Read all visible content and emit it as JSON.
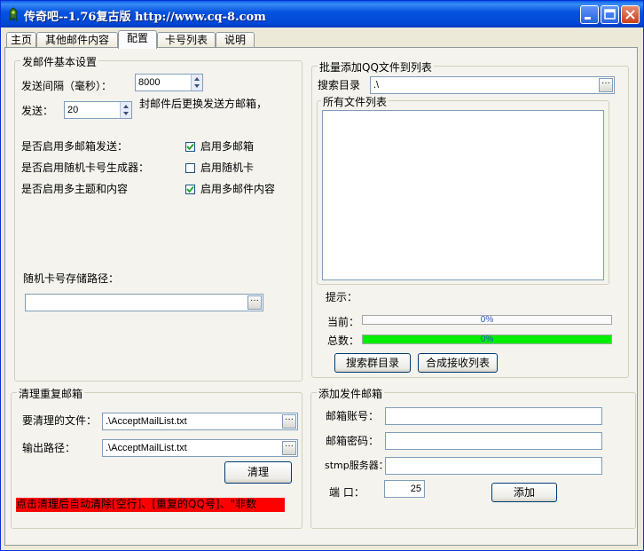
{
  "window": {
    "title": "传奇吧--1.76复古版 http://www.cq-8.com"
  },
  "tabs": [
    "主页",
    "其他邮件内容",
    "配置",
    "卡号列表",
    "说明"
  ],
  "mail_settings": {
    "legend": "发邮件基本设置",
    "interval_label": "发送间隔（毫秒）：",
    "interval_value": "8000",
    "send_label": "发送：",
    "send_value": "20",
    "send_suffix": "封邮件后更换发送方邮箱，",
    "multi_mailbox_label": "是否启用多邮箱发送：",
    "multi_mailbox_check": "启用多邮箱",
    "multi_mailbox_checked": true,
    "random_card_label": "是否启用随机卡号生成器：",
    "random_card_check": "启用随机卡",
    "random_card_checked": false,
    "multi_subject_label": "是否启用多主题和内容",
    "multi_subject_check": "启用多邮件内容",
    "multi_subject_checked": true,
    "card_path_label": "随机卡号存储路径：",
    "card_path_value": ""
  },
  "batch_add": {
    "legend": "批量添加QQ文件到列表",
    "search_dir_label": "搜索目录",
    "search_dir_value": ".\\",
    "file_list_legend": "所有文件列表",
    "hint_label": "提示：",
    "current_label": "当前：",
    "current_progress": "0%",
    "current_fraction": 0,
    "total_label": "总数：",
    "total_progress": "0%",
    "total_fraction": 1,
    "search_button": "搜索群目录",
    "merge_button": "合成接收列表"
  },
  "cleanup": {
    "legend": "清理重复邮箱",
    "file_label": "要清理的文件：",
    "file_value": ".\\AcceptMailList.txt",
    "output_label": "输出路径：",
    "output_value": ".\\AcceptMailList.txt",
    "clean_button": "清理",
    "warning": "点击清理后自动清除[空行]、[重复的QQ号]、\"非数"
  },
  "add_sender": {
    "legend": "添加发件邮箱",
    "account_label": "邮箱账号：",
    "password_label": "邮箱密码：",
    "smtp_label": "stmp服务器：",
    "port_label": "端  口：",
    "port_value": "25",
    "add_button": "添加"
  },
  "colors": {
    "titlebar": "#0054e3",
    "progress_fill": "#00ee00",
    "warning_bg": "#ff0000"
  }
}
